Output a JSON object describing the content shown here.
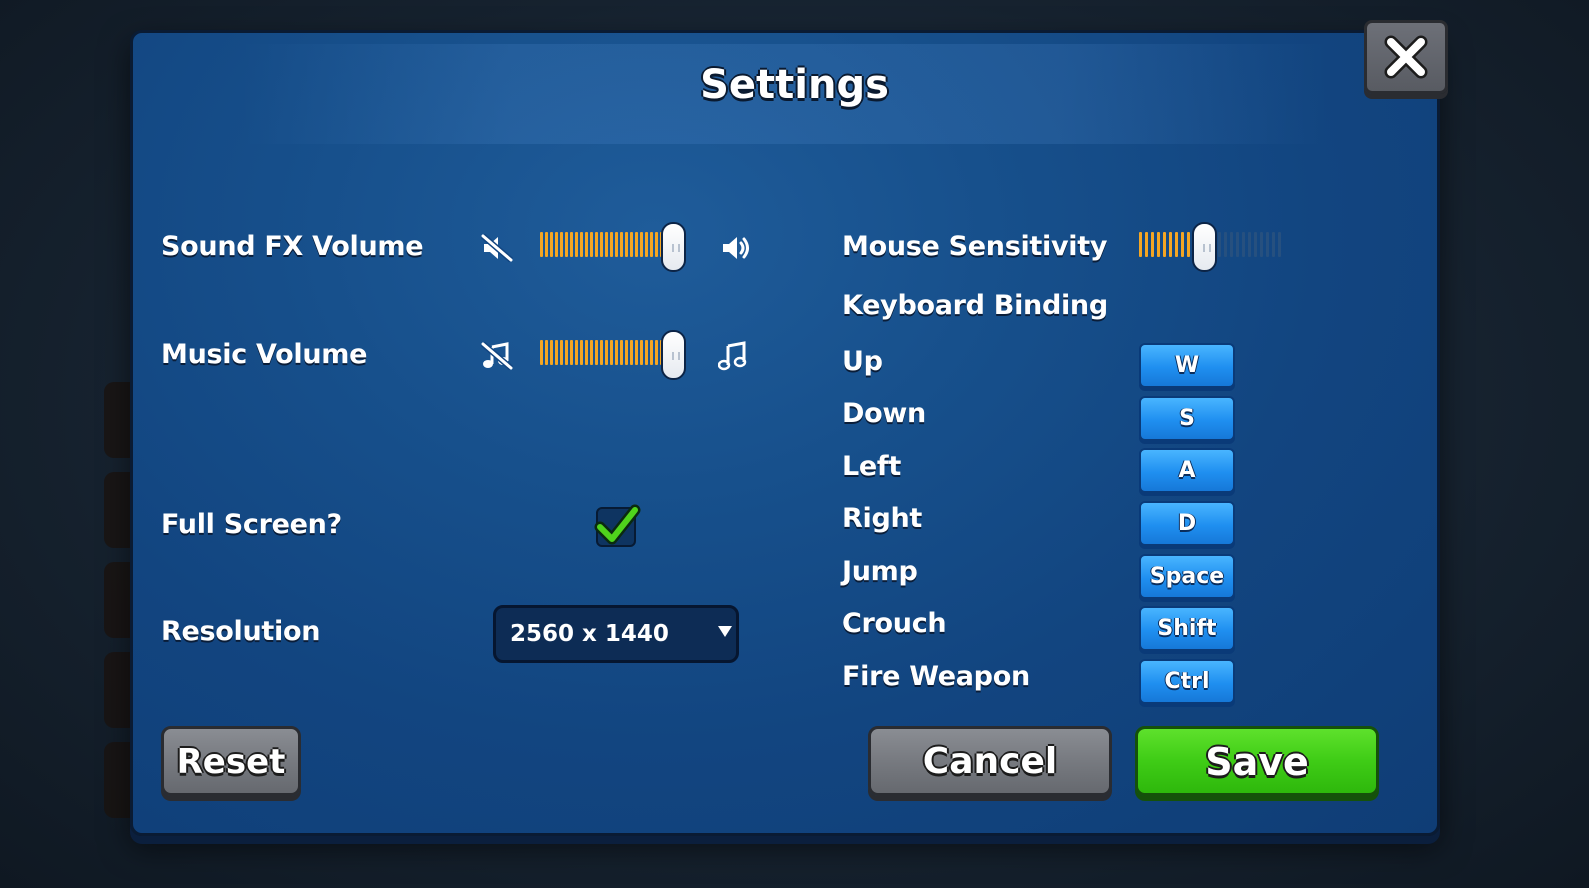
{
  "dialog": {
    "title": "Settings"
  },
  "audio": {
    "sound_fx": {
      "label": "Sound FX Volume",
      "level": 0.95,
      "low_icon": "speaker-muted-icon",
      "high_icon": "speaker-icon"
    },
    "music": {
      "label": "Music Volume",
      "level": 0.95,
      "low_icon": "music-muted-icon",
      "high_icon": "music-note-icon"
    }
  },
  "display": {
    "fullscreen": {
      "label": "Full Screen?",
      "checked": true
    },
    "resolution": {
      "label": "Resolution",
      "value": "2560 x 1440"
    }
  },
  "mouse": {
    "label": "Mouse Sensitivity",
    "level": 0.45
  },
  "keyboard": {
    "heading": "Keyboard Binding",
    "bindings": [
      {
        "action": "Up",
        "key": "W"
      },
      {
        "action": "Down",
        "key": "S"
      },
      {
        "action": "Left",
        "key": "A"
      },
      {
        "action": "Right",
        "key": "D"
      },
      {
        "action": "Jump",
        "key": "Space"
      },
      {
        "action": "Crouch",
        "key": "Shift"
      },
      {
        "action": "Fire Weapon",
        "key": "Ctrl"
      }
    ]
  },
  "buttons": {
    "reset": "Reset",
    "cancel": "Cancel",
    "save": "Save"
  },
  "colors": {
    "accent_orange": "#f5a623",
    "save_green": "#3fcc16",
    "key_blue": "#1f8ff0",
    "panel_blue": "#124580"
  }
}
